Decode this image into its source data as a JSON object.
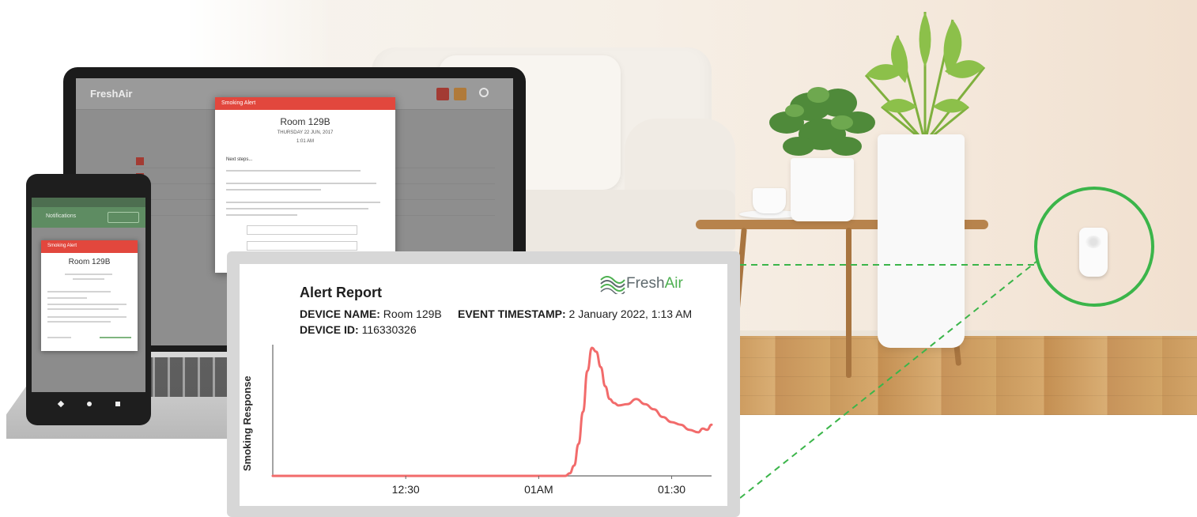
{
  "laptop": {
    "app_logo": "FreshAir",
    "modal": {
      "header": "Smoking Alert",
      "room": "Room 129B",
      "date": "THURSDAY 22 JUN, 2017",
      "time": "1:01 AM",
      "next_steps": "Next steps..."
    }
  },
  "phone": {
    "appbar_title": "Notifications",
    "card": {
      "header": "Smoking Alert",
      "room": "Room 129B"
    }
  },
  "report": {
    "title": "Alert Report",
    "device_name_label": "DEVICE NAME:",
    "device_name": "Room 129B",
    "device_id_label": "DEVICE ID:",
    "device_id": "116330326",
    "event_timestamp_label": "EVENT TIMESTAMP:",
    "event_timestamp": "2 January 2022, 1:13 AM",
    "logo_fresh": "Fresh",
    "logo_air": "Air"
  },
  "colors": {
    "line": "#f26b6b",
    "ring": "#3bb54a",
    "alert_red": "#e2473d",
    "logo_green": "#4db050"
  },
  "chart_data": {
    "type": "line",
    "title": "",
    "xlabel": "",
    "ylabel": "Smoking Response",
    "x_ticks": [
      "12:30",
      "01AM",
      "01:30"
    ],
    "x_tick_minutes": [
      30,
      60,
      90
    ],
    "xlim_minutes": [
      0,
      99
    ],
    "ylim": [
      0,
      1
    ],
    "grid": false,
    "series": [
      {
        "x": [
          0,
          30,
          60,
          66,
          67,
          68,
          69,
          70,
          71,
          72,
          73,
          74,
          75,
          76,
          77,
          78,
          80,
          82,
          84,
          86,
          88,
          90,
          92,
          94,
          96,
          97,
          98,
          99
        ],
        "y": [
          0,
          0,
          0,
          0,
          0.02,
          0.08,
          0.25,
          0.5,
          0.82,
          1.0,
          0.97,
          0.85,
          0.7,
          0.6,
          0.57,
          0.55,
          0.56,
          0.6,
          0.56,
          0.52,
          0.46,
          0.42,
          0.4,
          0.36,
          0.34,
          0.37,
          0.36,
          0.4
        ]
      }
    ]
  }
}
